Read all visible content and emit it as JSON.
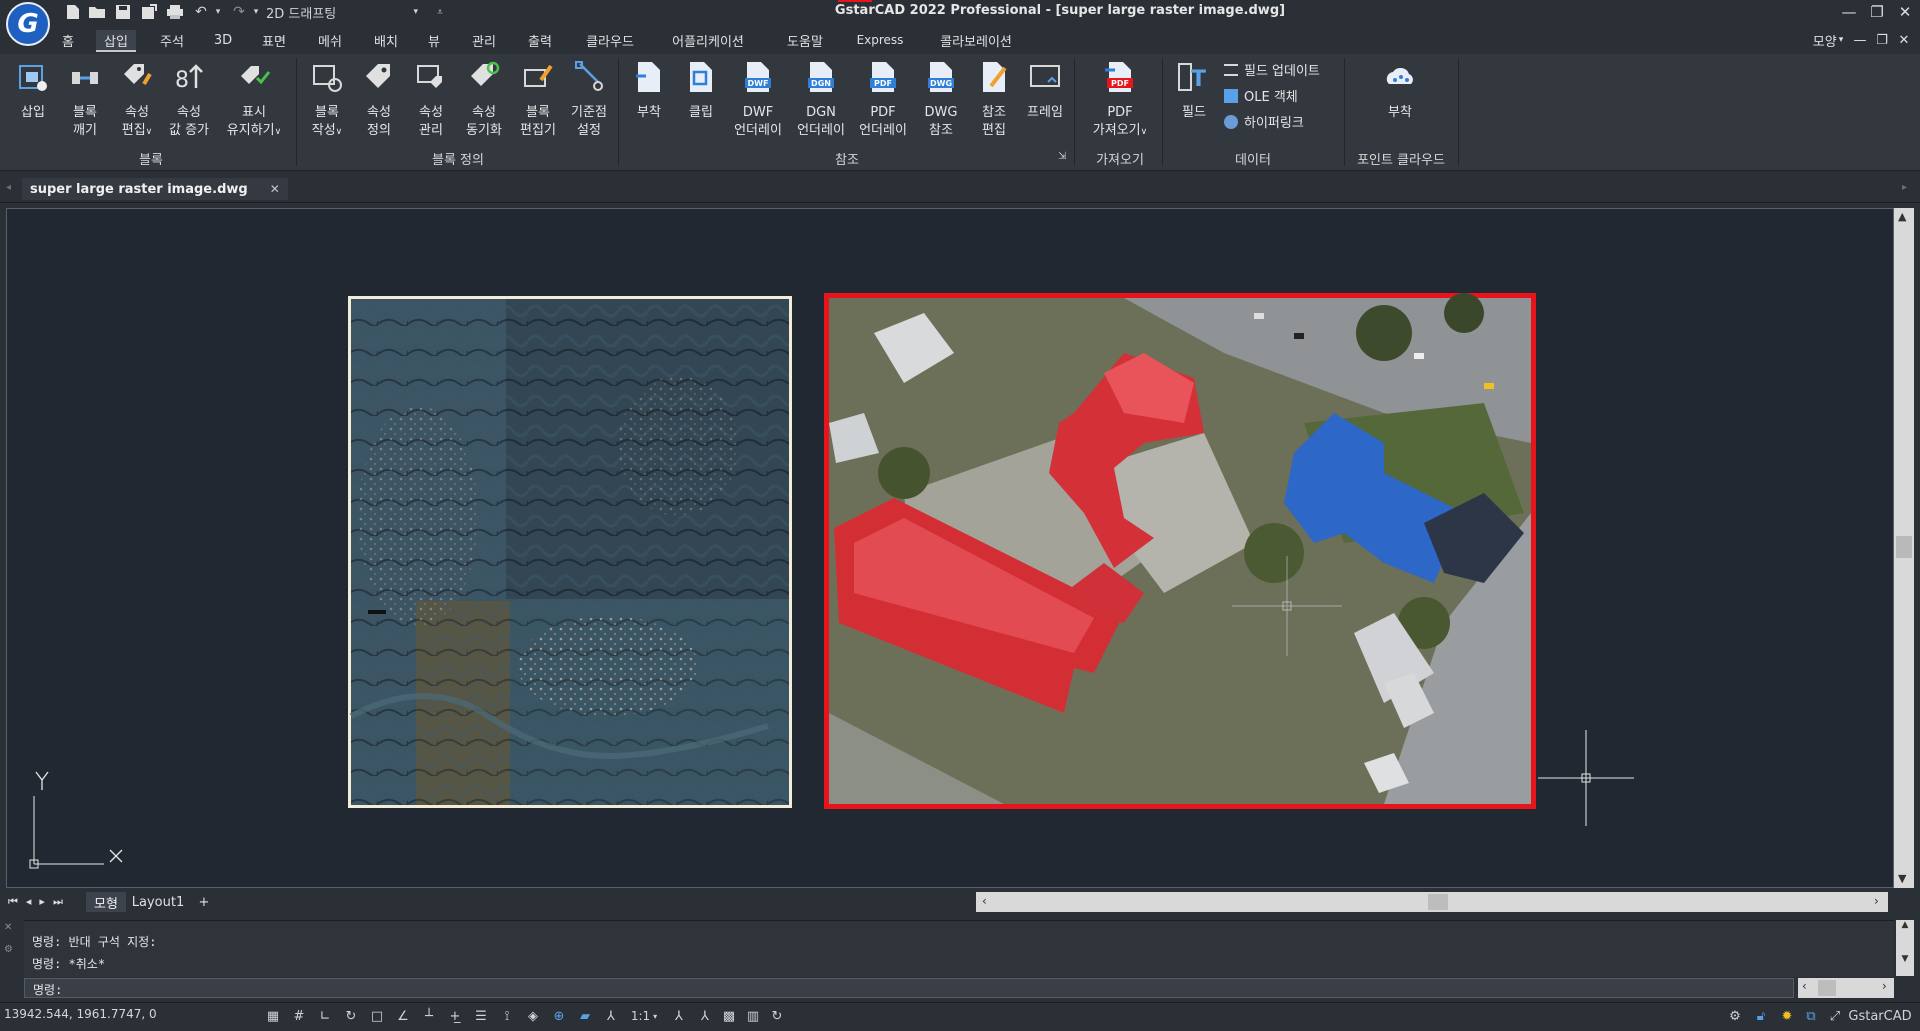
{
  "window": {
    "title": "GstarCAD 2022 Professional - [super large raster image.dwg]",
    "logo_letter": "G",
    "workspace": "2D 드래프팅",
    "minimize": "—",
    "restore": "❐",
    "close": "✕"
  },
  "menu_tabs": [
    "홈",
    "삽입",
    "주석",
    "3D",
    "표면",
    "메쉬",
    "배치",
    "뷰",
    "관리",
    "출력",
    "클라우드",
    "어플리케이션",
    "도움말",
    "Express",
    "콜라보레이션"
  ],
  "menu_right": {
    "mode": "모양",
    "min": "—",
    "restore": "❐",
    "close": "✕"
  },
  "ribbon": {
    "block_panel": {
      "label": "블록",
      "buttons": [
        {
          "line1": "삽입",
          "line2": ""
        },
        {
          "line1": "블록",
          "line2": "깨기"
        },
        {
          "line1": "속성",
          "line2": "편집"
        },
        {
          "line1": "속성",
          "line2": "값 증가"
        },
        {
          "line1": "표시",
          "line2": "유지하기"
        }
      ]
    },
    "blockdef_panel": {
      "label": "블록 정의",
      "buttons": [
        {
          "line1": "블록",
          "line2": "작성"
        },
        {
          "line1": "속성",
          "line2": "정의"
        },
        {
          "line1": "속성",
          "line2": "관리"
        },
        {
          "line1": "속성",
          "line2": "동기화"
        },
        {
          "line1": "블록",
          "line2": "편집기"
        },
        {
          "line1": "기준점",
          "line2": "설정"
        }
      ]
    },
    "reference_panel": {
      "label": "참조",
      "buttons": [
        {
          "line1": "부착",
          "line2": "",
          "badge": ""
        },
        {
          "line1": "클립",
          "line2": "",
          "badge": ""
        },
        {
          "line1": "DWF",
          "line2": "언더레이",
          "badge": "DWF"
        },
        {
          "line1": "DGN",
          "line2": "언더레이",
          "badge": "DGN"
        },
        {
          "line1": "PDF",
          "line2": "언더레이",
          "badge": "PDF"
        },
        {
          "line1": "DWG",
          "line2": "참조",
          "badge": "DWG"
        },
        {
          "line1": "참조",
          "line2": "편집",
          "badge": ""
        },
        {
          "line1": "프레임",
          "line2": "",
          "badge": ""
        }
      ]
    },
    "import_panel": {
      "label": "가져오기",
      "button": {
        "line1": "PDF",
        "line2": "가져오기",
        "badge": "PDF"
      }
    },
    "data_panel": {
      "label": "데이터",
      "field": "필드",
      "small": [
        "필드 업데이트",
        "OLE 객체",
        "하이퍼링크"
      ]
    },
    "pointcloud_panel": {
      "label": "포인트 클라우드",
      "button": "부착"
    }
  },
  "doc_tab": {
    "name": "super large raster image.dwg",
    "close": "✕"
  },
  "layout_tabs": [
    "모형",
    "Layout1",
    "+"
  ],
  "ucs": {
    "x": "X",
    "y": "Y"
  },
  "command": {
    "lines": [
      "명령: 반대 구석 지정:",
      "명령: *취소*"
    ],
    "prompt": "명령:"
  },
  "status": {
    "coords": "13942.544, 1961.7747, 0",
    "scale": "1:1",
    "app": "GstarCAD"
  },
  "colors": {
    "accent": "#1e5fbf",
    "selection": "#e8141b",
    "canvas": "#212832"
  }
}
